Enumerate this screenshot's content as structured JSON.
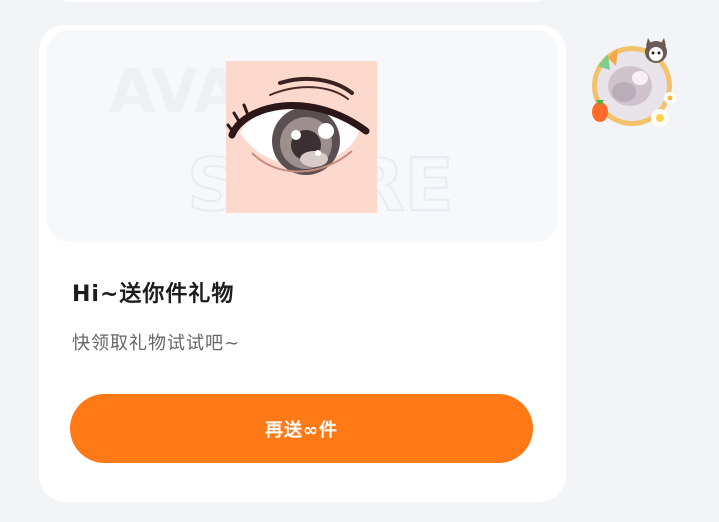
{
  "gift_card": {
    "title": "Hi~送你件礼物",
    "subtitle": "快领取礼物试试吧~",
    "send_again_label": "再送∞件",
    "watermark": "AVATAR STORE"
  },
  "avatar": {
    "icon": "user-avatar-with-frame"
  },
  "colors": {
    "page_background": "#f2f4f7",
    "card_background": "#ffffff",
    "preview_background": "#f7f8fb",
    "button_background": "#ff7a17",
    "button_text": "#ffffff",
    "title_text": "#1d1d1d",
    "subtitle_text": "#666666"
  }
}
